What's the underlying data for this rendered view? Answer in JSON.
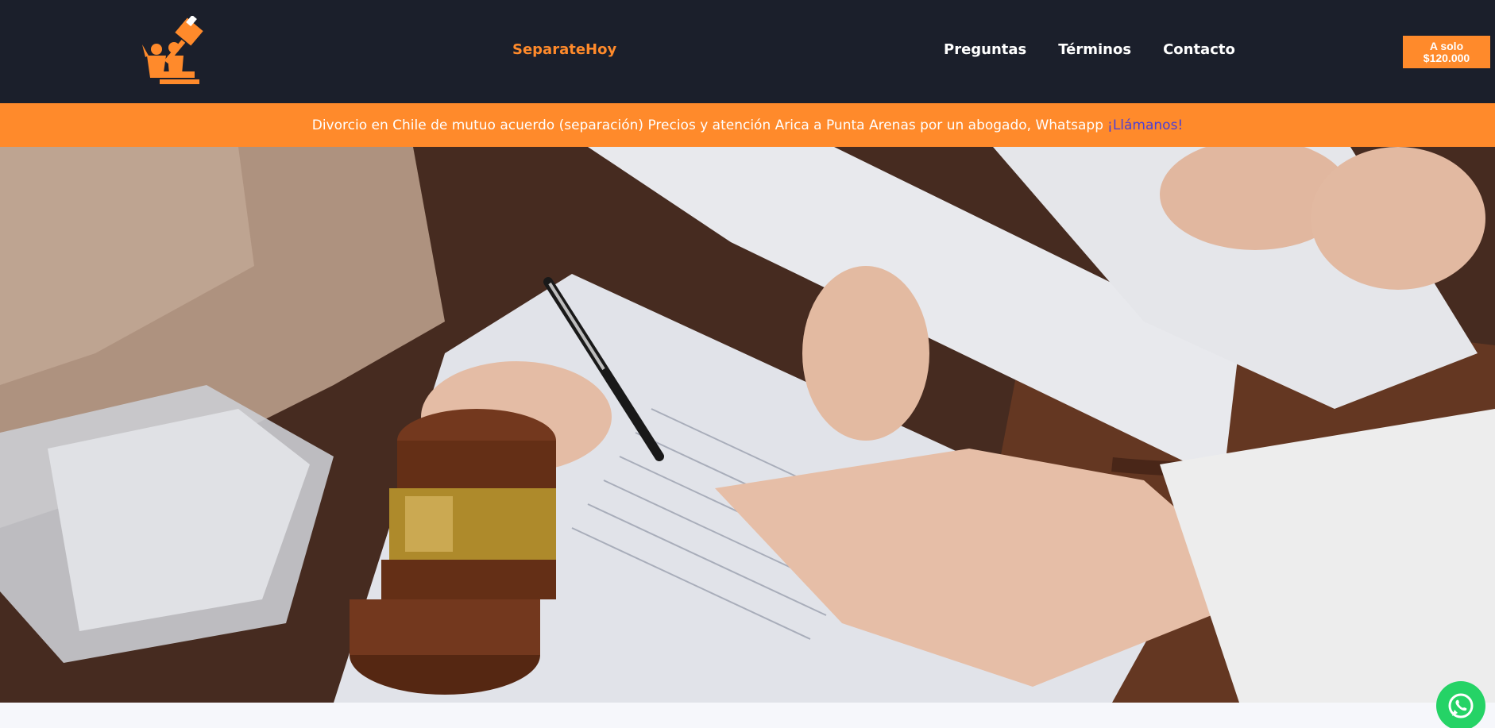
{
  "header": {
    "brand": "SeparateHoy",
    "nav": [
      "Preguntas",
      "Términos",
      "Contacto"
    ],
    "price_line1": "A solo",
    "price_line2": "$120.000"
  },
  "banner": {
    "text": "Divorcio en Chile de mutuo acuerdo (separación) Precios y atención Arica a Punta Arenas por un abogado, Whatsapp",
    "link": "¡Llámanos!"
  },
  "icons": {
    "logo": "gavel-family-logo-icon",
    "whatsapp": "whatsapp-icon"
  },
  "colors": {
    "header_bg": "#1b1f2b",
    "accent": "#ff8a2b",
    "banner_link": "#4b3fd6",
    "whatsapp": "#25d366"
  }
}
